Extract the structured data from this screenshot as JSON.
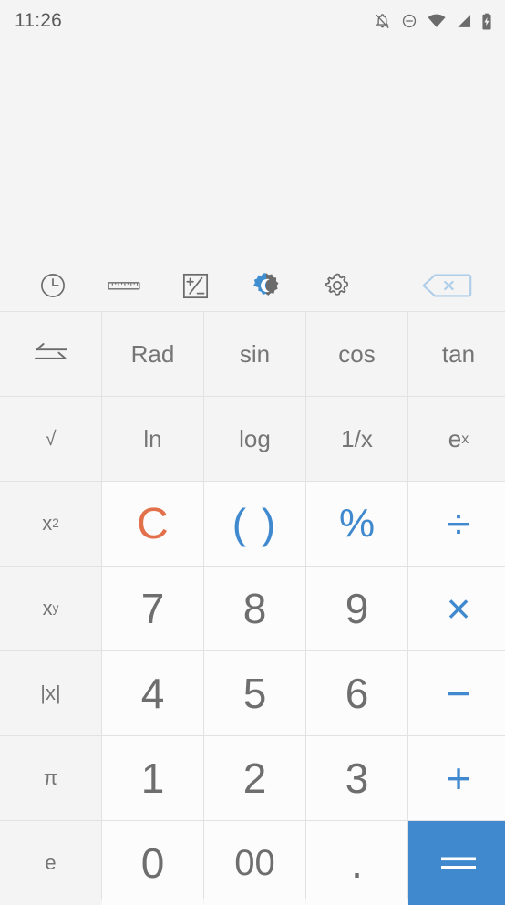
{
  "status_bar": {
    "time": "11:26",
    "icons": [
      {
        "name": "notifications-off-icon",
        "label": "Notifications muted"
      },
      {
        "name": "do-not-disturb-icon",
        "label": "Do not disturb"
      },
      {
        "name": "wifi-icon",
        "label": "Wi-Fi"
      },
      {
        "name": "cellular-signal-icon",
        "label": "Cellular signal"
      },
      {
        "name": "battery-charging-icon",
        "label": "Battery charging"
      }
    ]
  },
  "display": {
    "expression": "",
    "result": ""
  },
  "toolbar": {
    "history_label": "History",
    "converter_label": "Unit converter",
    "fraction_label": "Mixed fraction",
    "theme_label": "Theme",
    "settings_label": "Settings",
    "backspace_label": "Backspace"
  },
  "colors": {
    "accent_blue": "#4089ce",
    "clear_orange": "#e2704a",
    "text_gray": "#6e6e6e",
    "panel_gray": "#f4f4f4",
    "key_white": "#fcfcfc",
    "divider": "#e2e2e2",
    "backspace_faded": "#aecde8"
  },
  "keypad": {
    "rows": [
      [
        {
          "name": "key-swap",
          "label": "",
          "icon": "swap-arrows-icon",
          "style": "fn"
        },
        {
          "name": "key-rad",
          "label": "Rad",
          "style": "sci"
        },
        {
          "name": "key-sin",
          "label": "sin",
          "style": "sci"
        },
        {
          "name": "key-cos",
          "label": "cos",
          "style": "sci"
        },
        {
          "name": "key-tan",
          "label": "tan",
          "style": "sci"
        }
      ],
      [
        {
          "name": "key-sqrt",
          "label": "√",
          "style": "fn"
        },
        {
          "name": "key-ln",
          "label": "ln",
          "style": "sci"
        },
        {
          "name": "key-log",
          "label": "log",
          "style": "sci"
        },
        {
          "name": "key-reciprocal",
          "label": "1/x",
          "style": "sci"
        },
        {
          "name": "key-e-power-x",
          "label": "e",
          "sup": "x",
          "style": "sci"
        }
      ],
      [
        {
          "name": "key-x-squared",
          "label": "x",
          "sup": "2",
          "style": "fn"
        },
        {
          "name": "key-clear",
          "label": "C",
          "style": "clear"
        },
        {
          "name": "key-parentheses",
          "label": "( )",
          "style": "blue paren"
        },
        {
          "name": "key-percent",
          "label": "%",
          "style": "blue"
        },
        {
          "name": "key-divide",
          "label": "÷",
          "style": "blue op-sym"
        }
      ],
      [
        {
          "name": "key-x-power-y",
          "label": "x",
          "sup": "y",
          "style": "fn"
        },
        {
          "name": "key-7",
          "label": "7",
          "style": "digit"
        },
        {
          "name": "key-8",
          "label": "8",
          "style": "digit"
        },
        {
          "name": "key-9",
          "label": "9",
          "style": "digit"
        },
        {
          "name": "key-multiply",
          "label": "×",
          "style": "blue op-sym"
        }
      ],
      [
        {
          "name": "key-absolute",
          "label": "|x|",
          "style": "fn"
        },
        {
          "name": "key-4",
          "label": "4",
          "style": "digit"
        },
        {
          "name": "key-5",
          "label": "5",
          "style": "digit"
        },
        {
          "name": "key-6",
          "label": "6",
          "style": "digit"
        },
        {
          "name": "key-subtract",
          "label": "−",
          "style": "blue op-sym"
        }
      ],
      [
        {
          "name": "key-pi",
          "label": "π",
          "style": "fn"
        },
        {
          "name": "key-1",
          "label": "1",
          "style": "digit"
        },
        {
          "name": "key-2",
          "label": "2",
          "style": "digit"
        },
        {
          "name": "key-3",
          "label": "3",
          "style": "digit"
        },
        {
          "name": "key-add",
          "label": "+",
          "style": "blue op-sym"
        }
      ],
      [
        {
          "name": "key-e",
          "label": "e",
          "style": "fn"
        },
        {
          "name": "key-0",
          "label": "0",
          "style": "digit"
        },
        {
          "name": "key-00",
          "label": "00",
          "style": "digit small"
        },
        {
          "name": "key-decimal",
          "label": ".",
          "style": "dot"
        },
        {
          "name": "key-equals",
          "label": "=",
          "style": "equals"
        }
      ]
    ]
  }
}
